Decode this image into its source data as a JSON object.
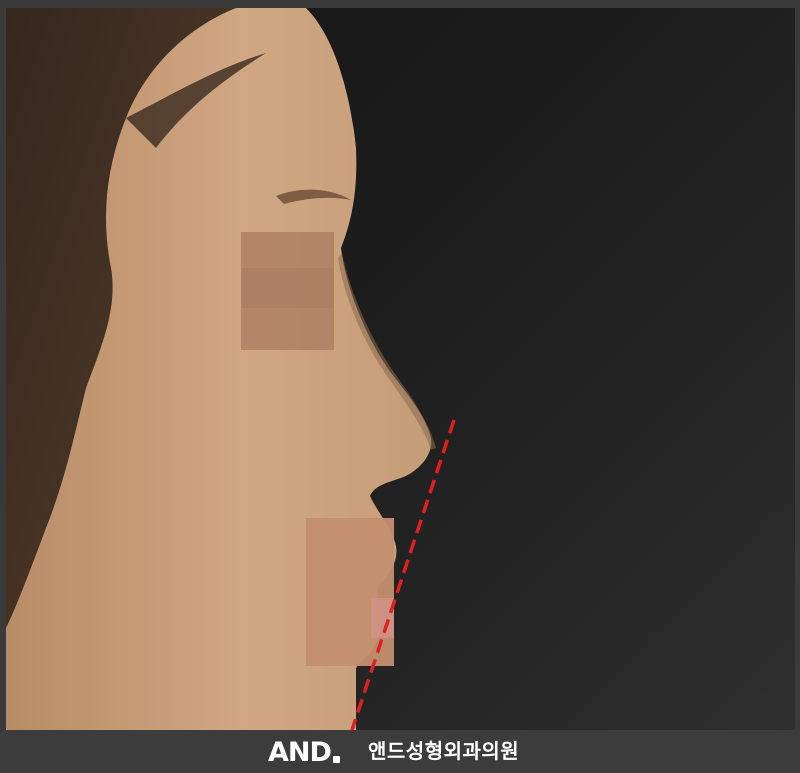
{
  "photo": {
    "description_icon": "profile-photo",
    "guide_line_color": "#e02020",
    "skin_color": "#c9a27e",
    "background_color": "#1c1c1c"
  },
  "footer": {
    "logo_text": "AND",
    "clinic_name": "앤드성형외과의원"
  }
}
